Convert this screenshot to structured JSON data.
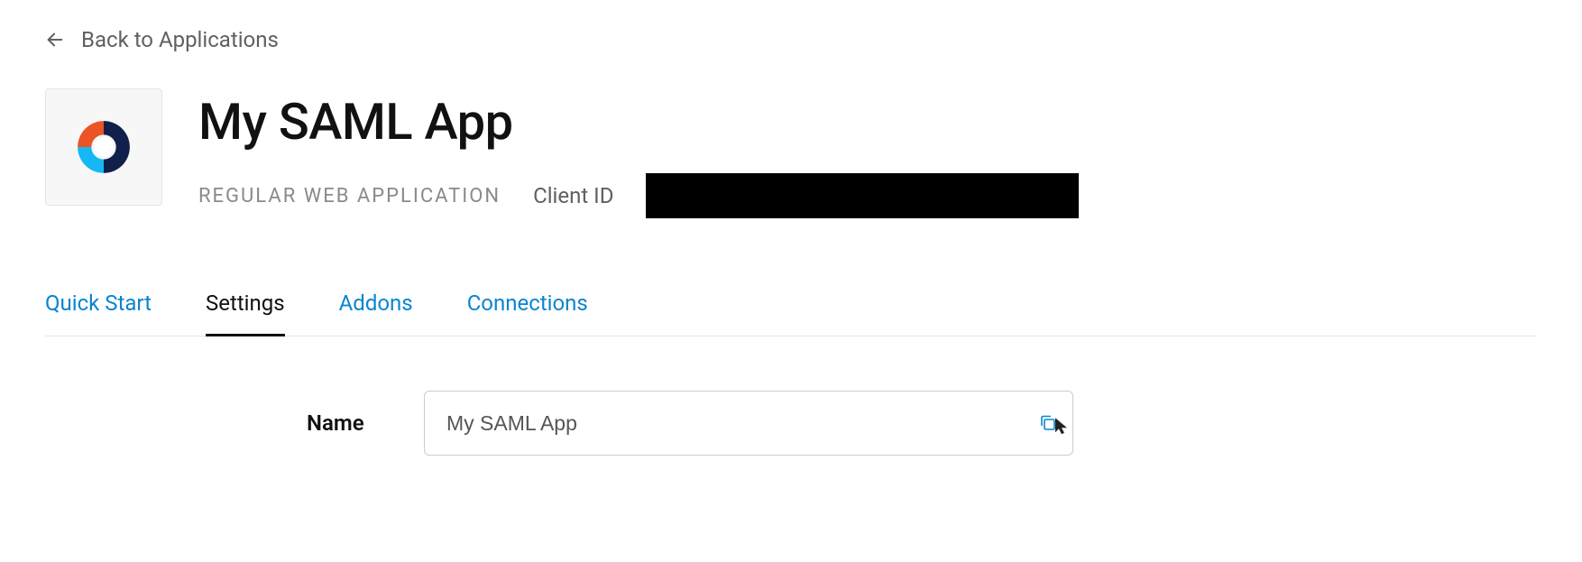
{
  "breadcrumb": {
    "back_label": "Back to Applications"
  },
  "header": {
    "title": "My SAML App",
    "app_type": "REGULAR WEB APPLICATION",
    "client_id_label": "Client ID",
    "client_id_value": "████████████████████████████████"
  },
  "tabs": [
    {
      "label": "Quick Start",
      "active": false
    },
    {
      "label": "Settings",
      "active": true
    },
    {
      "label": "Addons",
      "active": false
    },
    {
      "label": "Connections",
      "active": false
    }
  ],
  "form": {
    "name_label": "Name",
    "name_value": "My SAML App"
  },
  "colors": {
    "link": "#0a84d0",
    "text": "#111111",
    "muted": "#8a8a8a"
  }
}
